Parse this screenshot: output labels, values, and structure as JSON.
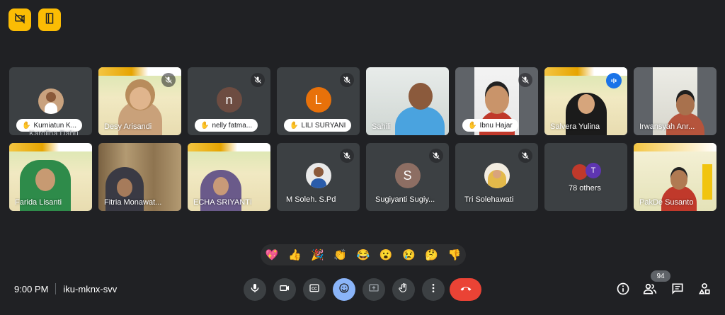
{
  "top_controls": [
    {
      "icon": "video-off-icon"
    },
    {
      "icon": "door-exit-icon"
    }
  ],
  "participants": [
    {
      "name": "Kurniatun K...",
      "subname": "Karolina Dahu",
      "type": "avatar-photo",
      "hand": true
    },
    {
      "name": "Desy Arisandi",
      "type": "video",
      "muted": true
    },
    {
      "name": "nelly fatma...",
      "type": "avatar-letter",
      "letter": "n",
      "color": "#6d4c41",
      "hand": true,
      "muted": true
    },
    {
      "name": "LILI SURYANI",
      "type": "avatar-letter",
      "letter": "L",
      "color": "#e8710a",
      "hand": true,
      "muted": true
    },
    {
      "name": "Sahili",
      "type": "video"
    },
    {
      "name": "Ibnu Hajar",
      "type": "video",
      "hand": true,
      "muted": true
    },
    {
      "name": "Salvera Yulina",
      "type": "video",
      "speaking": true
    },
    {
      "name": "Irwansyah Anr...",
      "type": "video"
    },
    {
      "name": "Farida Lisanti",
      "type": "video"
    },
    {
      "name": "Fitria Monawat...",
      "type": "video"
    },
    {
      "name": "ECHA SRIYANTI",
      "type": "video"
    },
    {
      "name": "M Soleh. S.Pd",
      "type": "avatar-photo",
      "muted": true
    },
    {
      "name": "Sugiyanti Sugiy...",
      "type": "avatar-letter",
      "letter": "S",
      "color": "#8d6e63",
      "muted": true
    },
    {
      "name": "Tri Solehawati",
      "type": "avatar-photo",
      "muted": true
    },
    {
      "name": "78 others",
      "type": "others",
      "letter": "T"
    },
    {
      "name": "PakDe Susanto",
      "type": "video"
    }
  ],
  "reactions": [
    "💖",
    "👍",
    "🎉",
    "👏",
    "😂",
    "😮",
    "😢",
    "🤔",
    "👎"
  ],
  "meeting": {
    "time": "9:00 PM",
    "code": "iku-mknx-svv"
  },
  "controls": [
    {
      "icon": "microphone-icon"
    },
    {
      "icon": "camera-icon"
    },
    {
      "icon": "captions-icon"
    },
    {
      "icon": "emoji-icon",
      "active": true
    },
    {
      "icon": "present-screen-icon"
    },
    {
      "icon": "raise-hand-icon"
    },
    {
      "icon": "more-options-icon"
    }
  ],
  "end_call": {
    "icon": "end-call-icon",
    "color": "#ea4335"
  },
  "right_controls": [
    {
      "icon": "info-icon"
    },
    {
      "icon": "people-icon"
    },
    {
      "icon": "chat-icon"
    },
    {
      "icon": "activities-icon"
    }
  ],
  "participant_count": "94",
  "colors": {
    "background": "#202124",
    "tile": "#3c4043",
    "accent": "#8ab4f8",
    "highlight": "#fbbc04"
  }
}
